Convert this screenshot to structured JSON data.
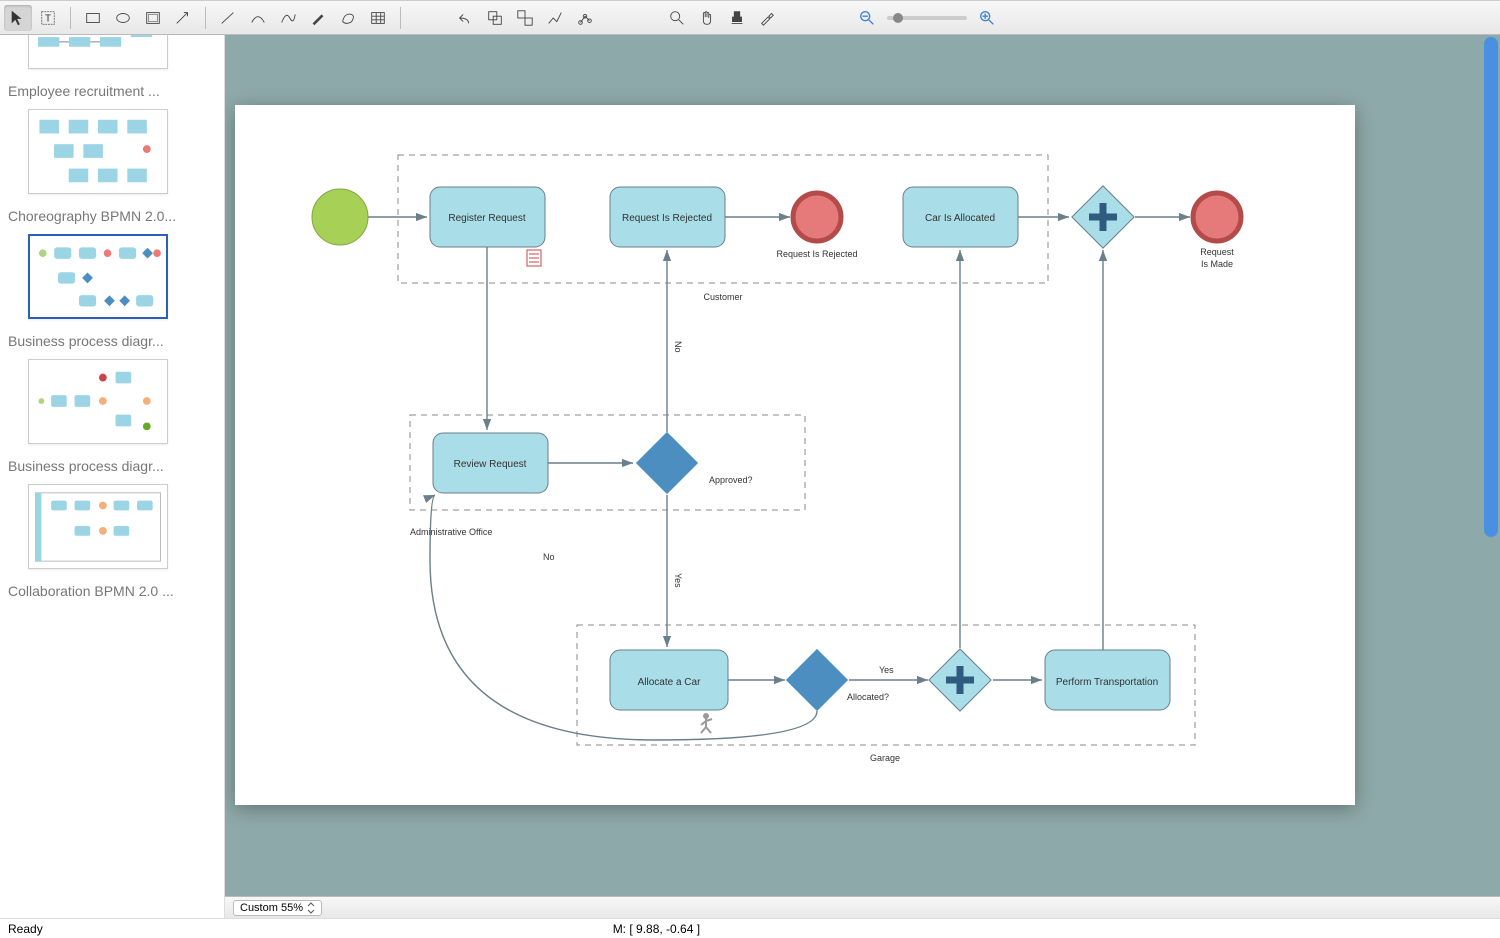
{
  "toolbar": {
    "tools": [
      "pointer",
      "text",
      "rect",
      "ellipse",
      "container",
      "arrow",
      "line",
      "arc",
      "curve",
      "pen",
      "lasso",
      "table"
    ],
    "actions": [
      "undo",
      "group",
      "ungroup",
      "align",
      "distribute"
    ],
    "view": [
      "zoom-fit",
      "pan",
      "stamp",
      "eyedrop"
    ]
  },
  "zoom": {
    "label": "Custom 55%"
  },
  "status": {
    "ready": "Ready",
    "coords": "M: [ 9.88, -0.64 ]"
  },
  "sidebar": {
    "items": [
      {
        "label": "Employee recruitment ..."
      },
      {
        "label": "Choreography BPMN 2.0..."
      },
      {
        "label": "Business process diagr..."
      },
      {
        "label": "Business process diagr..."
      },
      {
        "label": "Collaboration BPMN 2.0 ..."
      }
    ]
  },
  "diagram": {
    "pools": {
      "customer": "Customer",
      "admin": "Administrative Office",
      "garage": "Garage"
    },
    "tasks": {
      "register": "Register Request",
      "rejected_task": "Request Is Rejected",
      "allocated_task": "Car Is Allocated",
      "review": "Review Request",
      "allocate": "Allocate a Car",
      "perform": "Perform Transportation"
    },
    "events": {
      "rejected_end": "Request Is Rejected",
      "made_end_1": "Request",
      "made_end_2": "Is Made"
    },
    "gateways": {
      "approved": "Approved?",
      "allocated": "Allocated?"
    },
    "edges": {
      "no1": "No",
      "no2": "No",
      "yes1": "Yes",
      "yes2": "Yes"
    }
  }
}
